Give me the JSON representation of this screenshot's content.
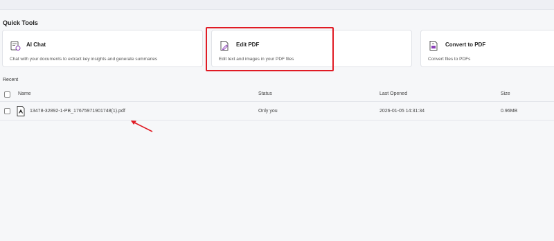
{
  "quick_tools": {
    "title": "Quick Tools",
    "cards": [
      {
        "title": "AI Chat",
        "description": "Chat with your documents to extract key insights and generate summaries",
        "icon": "ai-chat-icon"
      },
      {
        "title": "Edit PDF",
        "description": "Edit text and images in your PDF files",
        "icon": "edit-pdf-icon"
      },
      {
        "title": "Convert to PDF",
        "description": "Convert files to PDFs",
        "icon": "convert-to-pdf-icon"
      }
    ]
  },
  "recent": {
    "label": "Recent",
    "columns": {
      "name": "Name",
      "status": "Status",
      "last_opened": "Last Opened",
      "size": "Size"
    },
    "rows": [
      {
        "name": "13478-32892-1-PB_17675971901748(1).pdf",
        "status": "Only you",
        "last_opened": "2026-01-05 14:31:34",
        "size": "0.96MB",
        "icon": "pdf-file-icon"
      }
    ]
  },
  "colors": {
    "highlight": "#e01b24",
    "accent": "#8b3fb8"
  }
}
